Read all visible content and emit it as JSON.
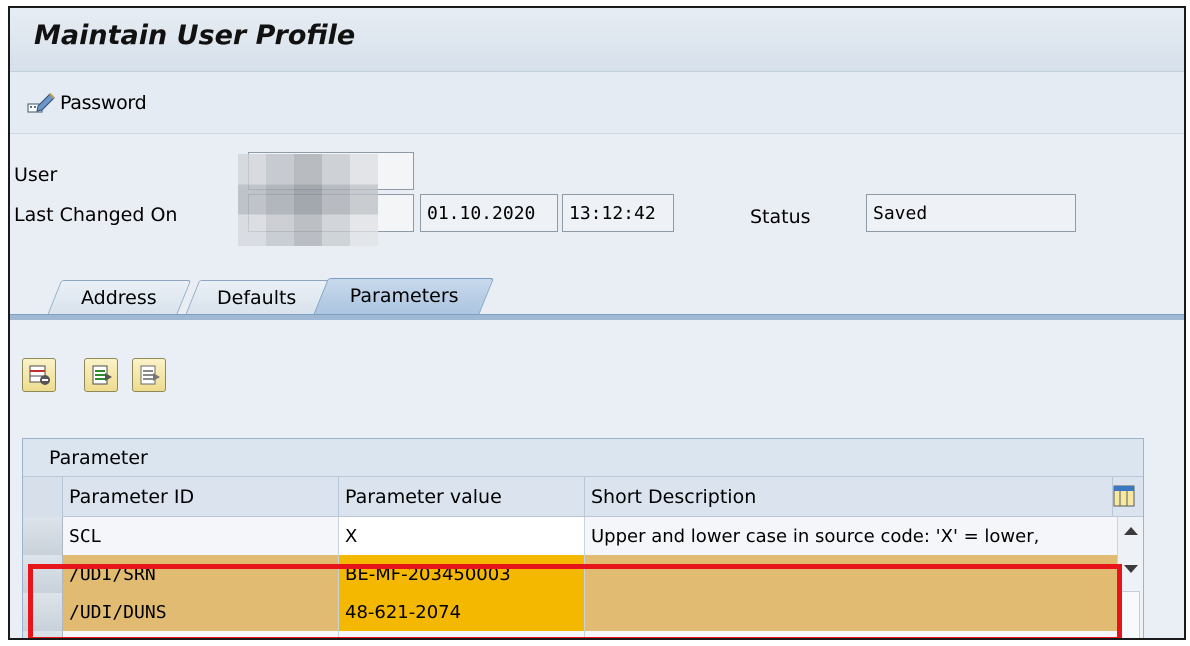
{
  "window": {
    "title": "Maintain User Profile"
  },
  "toolbar": {
    "password_label": "Password"
  },
  "header": {
    "user_label": "User",
    "last_changed_label": "Last Changed On",
    "date": "01.10.2020",
    "time": "13:12:42",
    "status_label": "Status",
    "status_value": "Saved"
  },
  "tabs": [
    {
      "label": "Address"
    },
    {
      "label": "Defaults"
    },
    {
      "label": "Parameters"
    }
  ],
  "table": {
    "title": "Parameter",
    "columns": [
      "Parameter ID",
      "Parameter value",
      "Short Description"
    ],
    "rows": [
      {
        "id": "SCL",
        "value": "X",
        "description": "Upper and lower case in source code: 'X' = lower,"
      },
      {
        "id": "/UDI/SRN",
        "value": "BE-MF-203450003",
        "description": ""
      },
      {
        "id": "/UDI/DUNS",
        "value": "48-621-2074",
        "description": ""
      }
    ]
  },
  "colors": {
    "highlight_border": "#e8141c",
    "highlight_row": "#e1bb72",
    "highlight_value": "#f5b800"
  },
  "icons": [
    "edit-password-icon",
    "delete-row-icon",
    "insert-row-icon",
    "append-row-icon",
    "column-settings-icon"
  ]
}
